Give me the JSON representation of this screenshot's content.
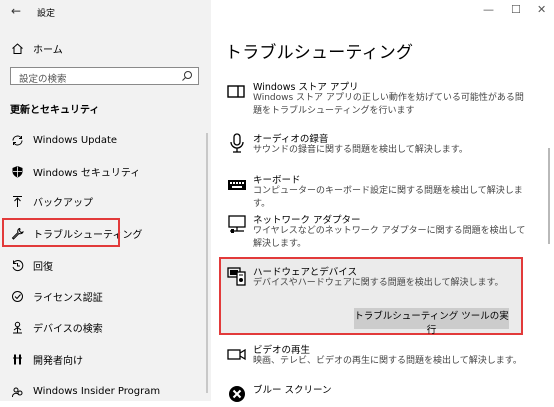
{
  "window": {
    "title": "設定",
    "back_glyph": "←",
    "minimize_glyph": "—",
    "maximize_glyph": "☐",
    "close_glyph": "✕"
  },
  "sidebar": {
    "home_label": "ホーム",
    "search_placeholder": "設定の検索",
    "section_title": "更新とセキュリティ",
    "items": [
      {
        "label": "Windows Update",
        "icon": "sync-icon"
      },
      {
        "label": "Windows セキュリティ",
        "icon": "shield-icon"
      },
      {
        "label": "バックアップ",
        "icon": "upload-icon"
      },
      {
        "label": "トラブルシューティング",
        "icon": "wrench-icon",
        "selected": true
      },
      {
        "label": "回復",
        "icon": "recovery-icon"
      },
      {
        "label": "ライセンス認証",
        "icon": "check-circle-icon"
      },
      {
        "label": "デバイスの検索",
        "icon": "person-pin-icon"
      },
      {
        "label": "開発者向け",
        "icon": "developer-icon"
      },
      {
        "label": "Windows Insider Program",
        "icon": "insider-icon"
      }
    ]
  },
  "main": {
    "title": "トラブルシューティング",
    "items": [
      {
        "title": "Windows ストア アプリ",
        "desc": "Windows ストア アプリの正しい動作を妨げている可能性がある問題をトラブルシューティングを行います",
        "icon": "store-app-icon"
      },
      {
        "title": "オーディオの録音",
        "desc": "サウンドの録音に関する問題を検出して解決します。",
        "icon": "microphone-icon"
      },
      {
        "title": "キーボード",
        "desc": "コンピューターのキーボード設定に関する問題を検出して解決します。",
        "icon": "keyboard-icon"
      },
      {
        "title": "ネットワーク アダプター",
        "desc": "ワイヤレスなどのネットワーク アダプターに関する問題を検出して解決します。",
        "icon": "network-adapter-icon"
      },
      {
        "title": "ハードウェアとデバイス",
        "desc": "デバイスやハードウェアに関する問題を検出して解決します。",
        "icon": "hardware-icon",
        "selected": true
      },
      {
        "title": "ビデオの再生",
        "desc": "映画、テレビ、ビデオの再生に関する問題を検出して解決します。",
        "icon": "video-icon"
      },
      {
        "title": "ブルー スクリーン",
        "desc": "",
        "icon": "bluescreen-icon"
      }
    ],
    "run_button_label": "トラブルシューティング ツールの実行"
  },
  "colors": {
    "highlight_border": "#e23a3a",
    "sidebar_bg": "#f2f2f2",
    "selected_bg": "#ebebeb",
    "button_bg": "#cccccc"
  }
}
